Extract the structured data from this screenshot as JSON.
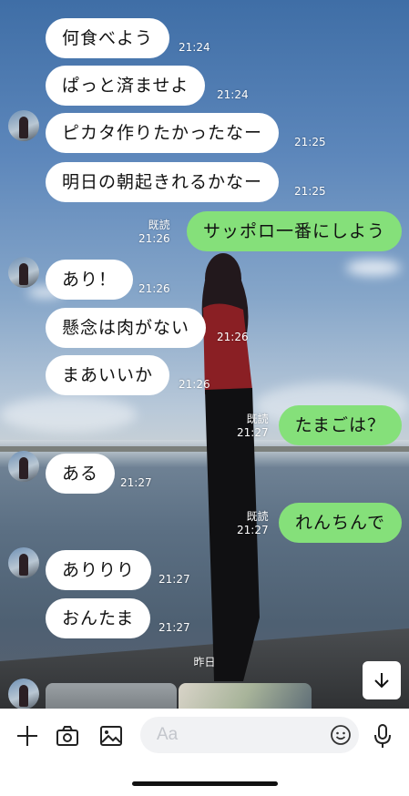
{
  "messages": [
    {
      "side": "left",
      "text": "何食べよう",
      "time": "21:24",
      "avatar": false
    },
    {
      "side": "left",
      "text": "ぱっと済ませよ",
      "time": "21:24",
      "avatar": false
    },
    {
      "side": "left",
      "text": "ピカタ作りたかったなー",
      "time": "21:25",
      "avatar": true
    },
    {
      "side": "left",
      "text": "明日の朝起きれるかなー",
      "time": "21:25",
      "avatar": false
    },
    {
      "side": "right",
      "text": "サッポロ一番にしよう",
      "time": "21:26",
      "read": "既読"
    },
    {
      "side": "left",
      "text": "あり！",
      "time": "21:26",
      "avatar": true
    },
    {
      "side": "left",
      "text": "懸念は肉がない",
      "time": "21:26",
      "avatar": false
    },
    {
      "side": "left",
      "text": "まあいいか",
      "time": "21:26",
      "avatar": false
    },
    {
      "side": "right",
      "text": "たまごは？",
      "time": "21:27",
      "read": "既読"
    },
    {
      "side": "left",
      "text": "ある",
      "time": "21:27",
      "avatar": true
    },
    {
      "side": "right",
      "text": "れんちんで",
      "time": "21:27",
      "read": "既読"
    },
    {
      "side": "left",
      "text": "ありりり",
      "time": "21:27",
      "avatar": true
    },
    {
      "side": "left",
      "text": "おんたま",
      "time": "21:27",
      "avatar": false
    }
  ],
  "date_separator": "昨日",
  "input": {
    "placeholder": "Aa"
  },
  "icons": {
    "plus": "plus-icon",
    "camera": "camera-icon",
    "image": "image-icon",
    "emoji": "emoji-icon",
    "mic": "microphone-icon",
    "scroll_down": "arrow-down-icon"
  },
  "colors": {
    "sent_bubble": "#85e07a",
    "received_bubble": "#ffffff"
  }
}
